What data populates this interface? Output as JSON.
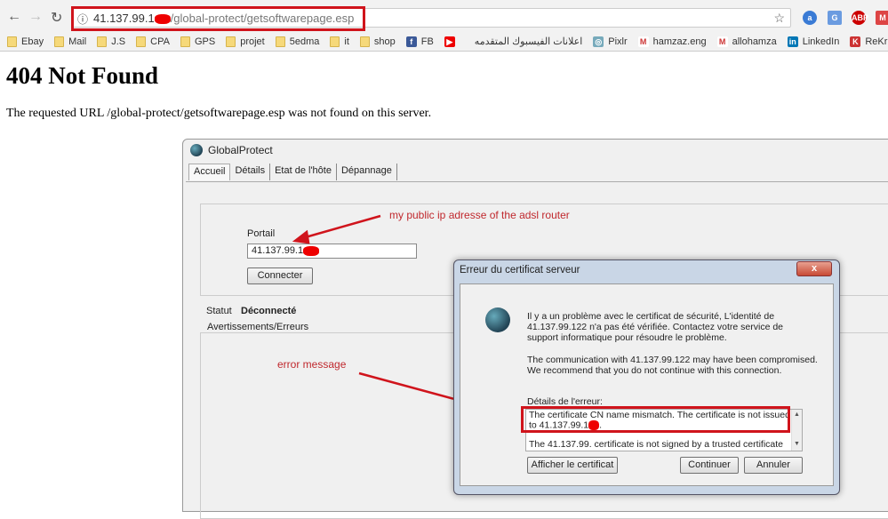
{
  "browser": {
    "url_host": "41.137.99.1",
    "url_path": "/global-protect/getsoftwarepage.esp",
    "bookmarks": [
      "Ebay",
      "Mail",
      "J.S",
      "CPA",
      "GPS",
      "projet",
      "5edma",
      "it",
      "shop",
      "FB",
      "",
      "اعلانات الفيسبوك المتقدمه",
      "Pixlr",
      "hamzaz.eng",
      "allohamza",
      "LinkedIn",
      "ReKrut"
    ]
  },
  "page": {
    "title": "404 Not Found",
    "message": "The requested URL /global-protect/getsoftwarepage.esp was not found on this server."
  },
  "gp": {
    "title": "GlobalProtect",
    "tabs": [
      "Accueil",
      "Détails",
      "Etat de l'hôte",
      "Dépannage"
    ],
    "portal_label": "Portail",
    "portal_value": "41.137.99.1",
    "connect": "Connecter",
    "status_label": "Statut",
    "status_value": "Déconnecté",
    "warnings": "Avertissements/Erreurs"
  },
  "dialog": {
    "title": "Erreur du certificat serveur",
    "close": "x",
    "p1": "Il y a un problème avec le certificat de sécurité, L'identité de 41.137.99.122 n'a pas été vérifiée. Contactez votre service de support informatique  pour résoudre le problème.",
    "p2": "The communication with 41.137.99.122 may have been compromised. We recommend that you do not continue with this connection.",
    "details_label": "Détails de l'erreur:",
    "detail1": "The certificate CN name mismatch. The certificate is not issued to 41.137.99.1",
    "detail2": "The 41.137.99.    certificate is not signed by a trusted certificate",
    "show_cert": "Afficher le certificat",
    "continue": "Continuer",
    "cancel": "Annuler"
  },
  "annotations": {
    "ip_note": "my public ip adresse of the adsl router",
    "error_note": "error message"
  }
}
